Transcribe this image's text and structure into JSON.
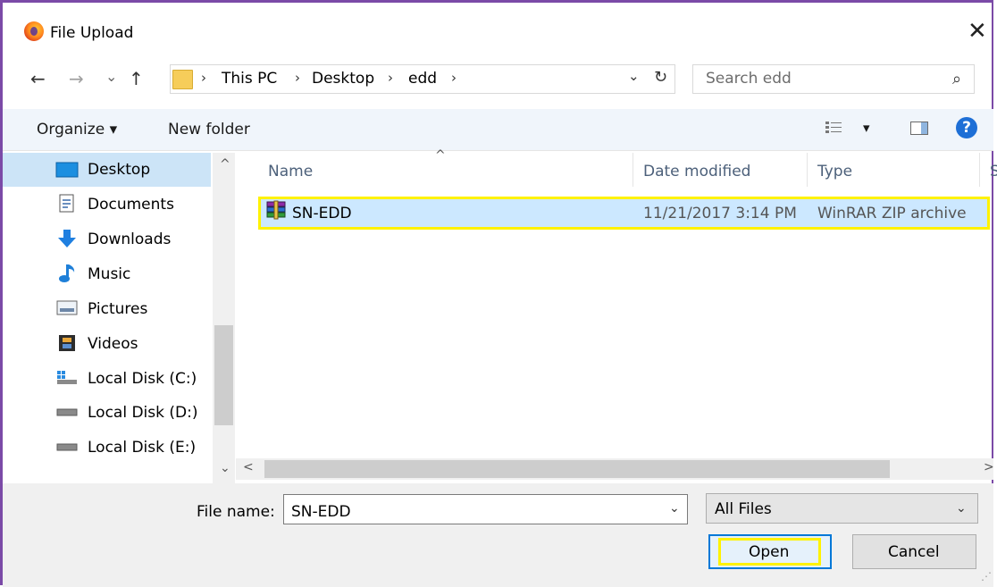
{
  "window": {
    "title": "File Upload",
    "close_glyph": "✕"
  },
  "nav": {
    "back_glyph": "←",
    "forward_glyph": "→",
    "recent_glyph": "⌄",
    "up_glyph": "↑",
    "breadcrumb": [
      "This PC",
      "Desktop",
      "edd"
    ],
    "separator": "›",
    "history_glyph": "⌄",
    "refresh_glyph": "↻",
    "search_placeholder": "Search edd",
    "search_glyph": "⌕"
  },
  "toolbar": {
    "organize": "Organize ▾",
    "new_folder": "New folder",
    "view_caret": "▾",
    "help_glyph": "?"
  },
  "sidebar": {
    "items": [
      {
        "label": "Desktop",
        "icon": "desktop-icon",
        "selected": true
      },
      {
        "label": "Documents",
        "icon": "documents-icon"
      },
      {
        "label": "Downloads",
        "icon": "downloads-icon"
      },
      {
        "label": "Music",
        "icon": "music-icon"
      },
      {
        "label": "Pictures",
        "icon": "pictures-icon"
      },
      {
        "label": "Videos",
        "icon": "videos-icon"
      },
      {
        "label": "Local Disk (C:)",
        "icon": "local-disk-c-icon"
      },
      {
        "label": "Local Disk (D:)",
        "icon": "drive-icon"
      },
      {
        "label": "Local Disk (E:)",
        "icon": "drive-icon"
      }
    ],
    "scroll_up_glyph": "^",
    "scroll_down_glyph": "⌄"
  },
  "file_list": {
    "columns": [
      "Name",
      "Date modified",
      "Type",
      "S"
    ],
    "sort_glyph": "^",
    "rows": [
      {
        "name": "SN-EDD",
        "date": "11/21/2017 3:14 PM",
        "type": "WinRAR ZIP archive",
        "icon": "winrar-archive-icon",
        "selected": true
      }
    ],
    "scroll_left_glyph": "<",
    "scroll_right_glyph": ">"
  },
  "footer": {
    "file_name_label": "File name:",
    "file_name_value": "SN-EDD",
    "file_type_value": "All Files",
    "dropdown_glyph": "⌄",
    "open_label": "Open",
    "cancel_label": "Cancel"
  },
  "colors": {
    "frame": "#7b4aa7",
    "highlight": "#fff200",
    "selection": "#cce8ff",
    "accent": "#0078d7"
  }
}
